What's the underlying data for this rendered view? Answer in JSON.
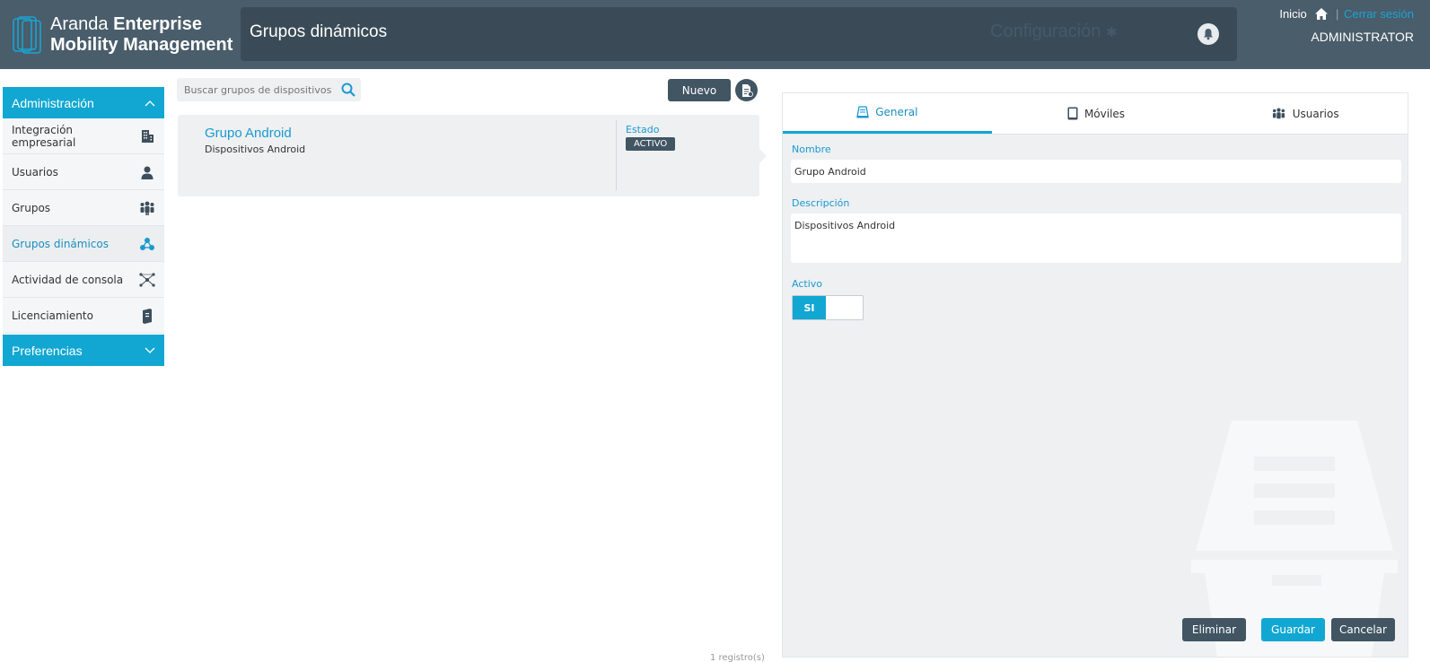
{
  "app": {
    "logo_line1_light": "Aranda",
    "logo_line1_bold": "Enterprise",
    "logo_line2": "Mobility Management"
  },
  "header": {
    "page_title": "Grupos dinámicos",
    "config_label": "Configuración",
    "home_label": "Inicio",
    "separator": "|",
    "logout_label": "Cerrar sesión",
    "user": "ADMINISTRATOR"
  },
  "sidebar": {
    "admin_header": "Administración",
    "items": [
      {
        "label": "Integración empresarial",
        "icon": "building-icon"
      },
      {
        "label": "Usuarios",
        "icon": "user-icon"
      },
      {
        "label": "Grupos",
        "icon": "people-icon"
      },
      {
        "label": "Grupos dinámicos",
        "icon": "dynamic-group-icon"
      },
      {
        "label": "Actividad de consola",
        "icon": "network-icon"
      },
      {
        "label": "Licenciamiento",
        "icon": "license-book-icon"
      }
    ],
    "pref_header": "Preferencias"
  },
  "list": {
    "search_placeholder": "Buscar grupos de dispositivos",
    "new_label": "Nuevo",
    "groups": [
      {
        "name": "Grupo Android",
        "description": "Dispositivos Android",
        "state_label": "Estado",
        "state": "ACTIVO"
      }
    ],
    "records": "1 registro(s)"
  },
  "detail": {
    "tabs": [
      {
        "label": "General",
        "icon": "general-icon",
        "active": true
      },
      {
        "label": "Móviles",
        "icon": "mobile-icon",
        "active": false
      },
      {
        "label": "Usuarios",
        "icon": "users-icon",
        "active": false
      }
    ],
    "name_label": "Nombre",
    "name_value": "Grupo Android",
    "desc_label": "Descripción",
    "desc_value": "Dispositivos Android",
    "active_label": "Activo",
    "active_toggle": "SI",
    "delete_label": "Eliminar",
    "save_label": "Guardar",
    "cancel_label": "Cancelar"
  },
  "colors": {
    "header_bg": "#4a5d6b",
    "accent": "#11a7d2",
    "dark_button": "#415563"
  }
}
